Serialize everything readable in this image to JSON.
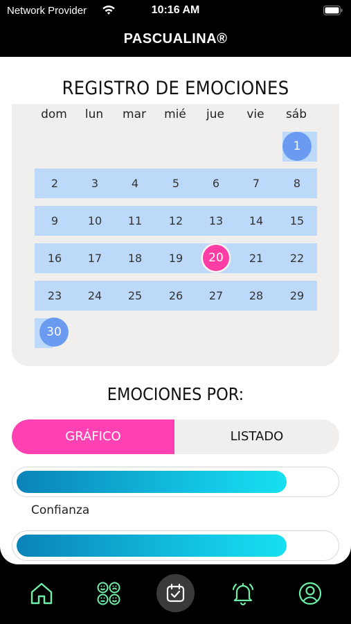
{
  "status": {
    "carrier": "Network Provider",
    "time": "10:16 AM"
  },
  "header": {
    "title": "PASCUALINA®"
  },
  "calendar": {
    "title": "REGISTRO DE EMOCIONES",
    "weekdays": [
      "dom",
      "lun",
      "mar",
      "mié",
      "jue",
      "vie",
      "sáb"
    ],
    "selected_day": "20",
    "days": {
      "d1": "1",
      "d2": "2",
      "d3": "3",
      "d4": "4",
      "d5": "5",
      "d6": "6",
      "d7": "7",
      "d8": "8",
      "d9": "9",
      "d10": "10",
      "d11": "11",
      "d12": "12",
      "d13": "13",
      "d14": "14",
      "d15": "15",
      "d16": "16",
      "d17": "17",
      "d18": "18",
      "d19": "19",
      "d20": "20",
      "d21": "21",
      "d22": "22",
      "d23": "23",
      "d24": "24",
      "d25": "25",
      "d26": "26",
      "d27": "27",
      "d28": "28",
      "d29": "29",
      "d30": "30"
    }
  },
  "emotions": {
    "title": "EMOCIONES POR:",
    "tab_grafico": "GRÁFICO",
    "tab_listado": "LISTADO",
    "bars": [
      {
        "label": "Confianza",
        "fraction": 0.85
      },
      {
        "label": "",
        "fraction": 0.85
      }
    ]
  },
  "tabbar": {
    "icons": [
      "home-icon",
      "emotions-faces-icon",
      "calendar-check-icon",
      "bell-icon",
      "user-icon"
    ]
  },
  "colors": {
    "accent_pink": "#ff41b3",
    "accent_green": "#6ff0a8",
    "band_blue": "#bcd9fa",
    "circle_blue": "#6a9bf0"
  }
}
